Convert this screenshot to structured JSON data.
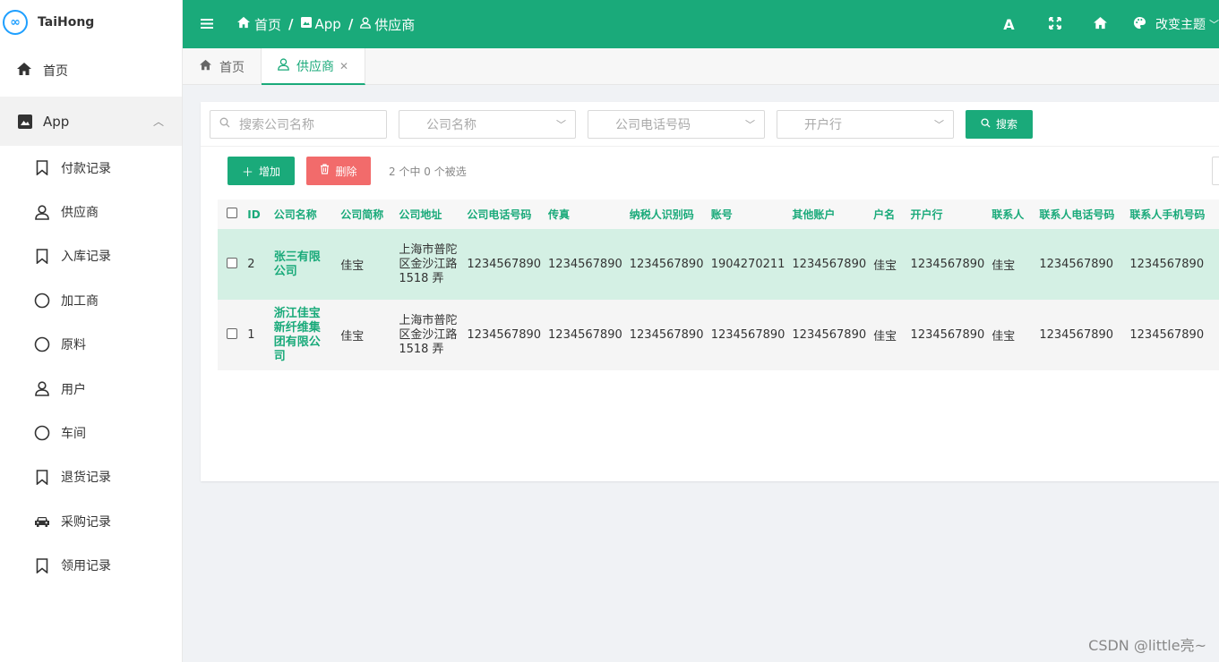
{
  "sidebar": {
    "logo_glyph": "∞",
    "brand": "TaiHong",
    "home_label": "首页",
    "app_label": "App",
    "items": [
      {
        "label": "付款记录",
        "icon": "bookmark-icon"
      },
      {
        "label": "供应商",
        "icon": "user-icon"
      },
      {
        "label": "入库记录",
        "icon": "bookmark-icon"
      },
      {
        "label": "加工商",
        "icon": "circle-icon"
      },
      {
        "label": "原料",
        "icon": "circle-icon"
      },
      {
        "label": "用户",
        "icon": "user-icon"
      },
      {
        "label": "车间",
        "icon": "circle-icon"
      },
      {
        "label": "退货记录",
        "icon": "bookmark-icon"
      },
      {
        "label": "采购记录",
        "icon": "car-icon"
      },
      {
        "label": "领用记录",
        "icon": "bookmark-icon"
      }
    ]
  },
  "header": {
    "crumbs": [
      "首页",
      "App",
      "供应商"
    ],
    "font_btn": "A",
    "theme_label": "改变主题",
    "bg_color": "#1aaa7a"
  },
  "tabs": [
    {
      "label": "首页",
      "active": false
    },
    {
      "label": "供应商",
      "active": true
    }
  ],
  "filters": {
    "search_placeholder": "搜索公司名称",
    "company_name": "公司名称",
    "company_phone": "公司电话号码",
    "bank": "开户行",
    "search_button": "搜索"
  },
  "actions": {
    "add_label": "增加",
    "delete_label": "删除",
    "selection_info": "2 个中 0 个被选"
  },
  "table": {
    "columns": [
      "ID",
      "公司名称",
      "公司简称",
      "公司地址",
      "公司电话号码",
      "传真",
      "纳税人识别码",
      "账号",
      "其他账户",
      "户名",
      "开户行",
      "联系人",
      "联系人电话号码",
      "联系人手机号码"
    ],
    "rows": [
      [
        "2",
        "张三有限公司",
        "佳宝",
        "上海市普陀区金沙江路 1518 弄",
        "1234567890",
        "1234567890",
        "1234567890",
        "1904270211",
        "1234567890",
        "佳宝",
        "1234567890",
        "佳宝",
        "1234567890",
        "1234567890"
      ],
      [
        "1",
        "浙江佳宝新纤维集团有限公司",
        "佳宝",
        "上海市普陀区金沙江路 1518 弄",
        "1234567890",
        "1234567890",
        "1234567890",
        "1234567890",
        "1234567890",
        "佳宝",
        "1234567890",
        "佳宝",
        "1234567890",
        "1234567890"
      ]
    ]
  },
  "watermark": "CSDN @little亮~"
}
